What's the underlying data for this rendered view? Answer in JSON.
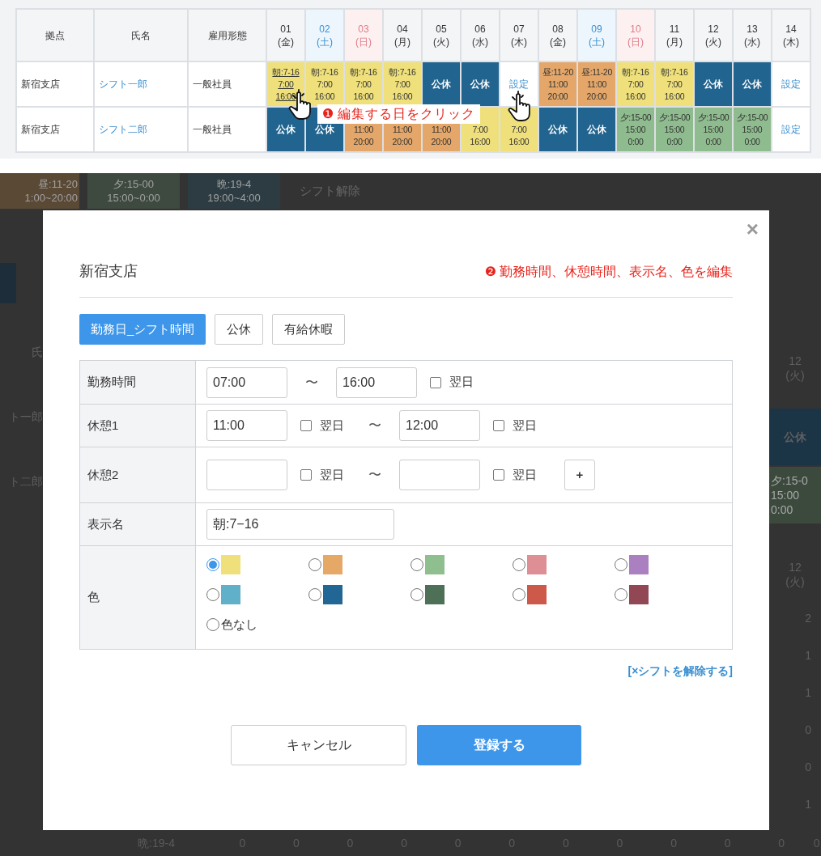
{
  "schedule_table": {
    "columns": [
      "拠点",
      "氏名",
      "雇用形態"
    ],
    "days": [
      {
        "date": "01",
        "weekday": "(金)",
        "kind": "weekday"
      },
      {
        "date": "02",
        "weekday": "(土)",
        "kind": "saturday"
      },
      {
        "date": "03",
        "weekday": "(日)",
        "kind": "sunday"
      },
      {
        "date": "04",
        "weekday": "(月)",
        "kind": "weekday"
      },
      {
        "date": "05",
        "weekday": "(火)",
        "kind": "weekday"
      },
      {
        "date": "06",
        "weekday": "(水)",
        "kind": "weekday"
      },
      {
        "date": "07",
        "weekday": "(木)",
        "kind": "weekday"
      },
      {
        "date": "08",
        "weekday": "(金)",
        "kind": "weekday"
      },
      {
        "date": "09",
        "weekday": "(土)",
        "kind": "saturday"
      },
      {
        "date": "10",
        "weekday": "(日)",
        "kind": "sunday"
      },
      {
        "date": "11",
        "weekday": "(月)",
        "kind": "weekday"
      },
      {
        "date": "12",
        "weekday": "(火)",
        "kind": "weekday"
      },
      {
        "date": "13",
        "weekday": "(水)",
        "kind": "weekday"
      },
      {
        "date": "14",
        "weekday": "(木)",
        "kind": "weekday"
      }
    ],
    "rows": [
      {
        "base": "新宿支店",
        "name": "シフト一郎",
        "employment": "一般社員",
        "cells": [
          {
            "kind": "shift",
            "color": "#efe07c",
            "lines": [
              "朝:7-16",
              "7:00",
              "16:00"
            ],
            "hovered": true
          },
          {
            "kind": "shift",
            "color": "#efe07c",
            "lines": [
              "朝:7-16",
              "7:00",
              "16:00"
            ],
            "hovered": false
          },
          {
            "kind": "shift",
            "color": "#efe07c",
            "lines": [
              "朝:7-16",
              "7:00",
              "16:00"
            ],
            "hovered": false
          },
          {
            "kind": "shift",
            "color": "#efe07c",
            "lines": [
              "朝:7-16",
              "7:00",
              "16:00"
            ],
            "hovered": false
          },
          {
            "kind": "holiday",
            "lines": [
              "公休"
            ],
            "hovered": false
          },
          {
            "kind": "holiday",
            "lines": [
              "公休"
            ],
            "hovered": false
          },
          {
            "kind": "unset",
            "lines": [
              "設定"
            ],
            "hovered": false
          },
          {
            "kind": "shift",
            "color": "#e4a769",
            "lines": [
              "昼:11-20",
              "11:00",
              "20:00"
            ],
            "hovered": false
          },
          {
            "kind": "shift",
            "color": "#e4a769",
            "lines": [
              "昼:11-20",
              "11:00",
              "20:00"
            ],
            "hovered": false
          },
          {
            "kind": "shift",
            "color": "#efe07c",
            "lines": [
              "朝:7-16",
              "7:00",
              "16:00"
            ],
            "hovered": false
          },
          {
            "kind": "shift",
            "color": "#efe07c",
            "lines": [
              "朝:7-16",
              "7:00",
              "16:00"
            ],
            "hovered": false
          },
          {
            "kind": "holiday",
            "lines": [
              "公休"
            ],
            "hovered": false
          },
          {
            "kind": "holiday",
            "lines": [
              "公休"
            ],
            "hovered": false
          },
          {
            "kind": "unset",
            "lines": [
              "設定"
            ],
            "hovered": false
          }
        ]
      },
      {
        "base": "新宿支店",
        "name": "シフト二郎",
        "employment": "一般社員",
        "cells": [
          {
            "kind": "holiday",
            "lines": [
              "公休"
            ],
            "hovered": false
          },
          {
            "kind": "holiday",
            "lines": [
              "公休"
            ],
            "hovered": false
          },
          {
            "kind": "shift",
            "color": "#e4a769",
            "lines": [
              "11:00",
              "20:00"
            ],
            "hovered": false
          },
          {
            "kind": "shift",
            "color": "#e4a769",
            "lines": [
              "11:00",
              "20:00"
            ],
            "hovered": false
          },
          {
            "kind": "shift",
            "color": "#e4a769",
            "lines": [
              "11:00",
              "20:00"
            ],
            "hovered": false
          },
          {
            "kind": "shift",
            "color": "#efe07c",
            "lines": [
              "7:00",
              "16:00"
            ],
            "hovered": false
          },
          {
            "kind": "shift",
            "color": "#efe07c",
            "lines": [
              "7:00",
              "16:00"
            ],
            "hovered": false
          },
          {
            "kind": "holiday",
            "lines": [
              "公休"
            ],
            "hovered": false
          },
          {
            "kind": "holiday",
            "lines": [
              "公休"
            ],
            "hovered": false
          },
          {
            "kind": "shift",
            "color": "#8fbc8f",
            "lines": [
              "夕:15-00",
              "15:00",
              "0:00"
            ],
            "hovered": false
          },
          {
            "kind": "shift",
            "color": "#8fbc8f",
            "lines": [
              "夕:15-00",
              "15:00",
              "0:00"
            ],
            "hovered": false
          },
          {
            "kind": "shift",
            "color": "#8fbc8f",
            "lines": [
              "夕:15-00",
              "15:00",
              "0:00"
            ],
            "hovered": false
          },
          {
            "kind": "shift",
            "color": "#8fbc8f",
            "lines": [
              "夕:15-00",
              "15:00",
              "0:00"
            ],
            "hovered": false
          },
          {
            "kind": "unset",
            "lines": [
              "設定"
            ],
            "hovered": false
          }
        ]
      }
    ]
  },
  "callout": {
    "number": "❶",
    "text": "編集する日をクリック"
  },
  "background_page": {
    "shift_buttons": [
      {
        "name": "昼:11-20",
        "time": "1:00~20:00",
        "color": "#5a4935"
      },
      {
        "name": "夕:15-00",
        "time": "15:00~0:00",
        "color": "#3e4a40"
      },
      {
        "name": "晩:19-4",
        "time": "19:00~4:00",
        "color": "#2c3c42"
      }
    ],
    "clear_button": "シフト解除",
    "left_column": [
      "氏",
      "ト一郎",
      "ト二郎"
    ],
    "right_column": [
      {
        "kind": "header",
        "lines": [
          "12",
          "(火)"
        ]
      },
      {
        "kind": "holiday",
        "lines": [
          "公休"
        ]
      },
      {
        "kind": "shift",
        "lines": [
          "夕:15-0",
          "15:00",
          "0:00"
        ]
      },
      {
        "kind": "header",
        "lines": [
          "12",
          "(火)"
        ]
      },
      {
        "kind": "count",
        "lines": [
          "2"
        ]
      },
      {
        "kind": "count",
        "lines": [
          "1"
        ]
      },
      {
        "kind": "count",
        "lines": [
          "1"
        ]
      },
      {
        "kind": "count",
        "lines": [
          "0"
        ]
      },
      {
        "kind": "count",
        "lines": [
          "0"
        ]
      },
      {
        "kind": "count",
        "lines": [
          "1"
        ]
      }
    ],
    "bottom_row": {
      "label": "晩:19-4",
      "values": [
        "0",
        "0",
        "0",
        "0",
        "0",
        "0",
        "0",
        "0",
        "0",
        "0",
        "0",
        "0"
      ]
    }
  },
  "dialog": {
    "title": "新宿支店",
    "close": "×",
    "annotation": {
      "number": "❷",
      "text": "勤務時間、休憩時間、表示名、色を編集"
    },
    "tabs": [
      {
        "label": "勤務日_シフト時間",
        "selected": true
      },
      {
        "label": "公休",
        "selected": false
      },
      {
        "label": "有給休暇",
        "selected": false
      }
    ],
    "form": [
      {
        "label": "勤務時間",
        "items": [
          {
            "kind": "input",
            "value": "07:00"
          },
          {
            "kind": "separator",
            "text": "〜"
          },
          {
            "kind": "input",
            "value": "16:00"
          },
          {
            "kind": "checkbox",
            "label": "翌日",
            "checked": false
          }
        ]
      },
      {
        "label": "休憩1",
        "items": [
          {
            "kind": "input",
            "value": "11:00"
          },
          {
            "kind": "checkbox",
            "label": "翌日",
            "checked": false
          },
          {
            "kind": "separator",
            "text": "〜"
          },
          {
            "kind": "input",
            "value": "12:00"
          },
          {
            "kind": "checkbox",
            "label": "翌日",
            "checked": false
          }
        ]
      },
      {
        "label": "休憩2",
        "items": [
          {
            "kind": "input"
          },
          {
            "kind": "checkbox",
            "label": "翌日",
            "checked": false
          },
          {
            "kind": "separator",
            "text": "〜"
          },
          {
            "kind": "input"
          },
          {
            "kind": "checkbox",
            "label": "翌日",
            "checked": false
          },
          {
            "kind": "button",
            "text": "+"
          }
        ]
      },
      {
        "label": "表示名",
        "items": [
          {
            "kind": "wide_input",
            "value": "朝:7−16"
          }
        ]
      },
      {
        "label": "色",
        "items": [
          {
            "kind": "colors",
            "options": [
              {
                "color": "#efe07c",
                "selected": true
              },
              {
                "color": "#e6a867",
                "selected": false
              },
              {
                "color": "#8fbf8f",
                "selected": false
              },
              {
                "color": "#de8e95",
                "selected": false
              },
              {
                "color": "#aa80c0",
                "selected": false
              },
              {
                "color": "#5fb0c8",
                "selected": false
              },
              {
                "color": "#216694",
                "selected": false
              },
              {
                "color": "#4e7056",
                "selected": false
              },
              {
                "color": "#cd594b",
                "selected": false
              },
              {
                "color": "#914754",
                "selected": false
              },
              {
                "label": "色なし",
                "selected": false
              }
            ]
          }
        ]
      }
    ],
    "clear_link": "[×シフトを解除する]",
    "buttons": [
      {
        "label": "キャンセル",
        "kind": "secondary"
      },
      {
        "label": "登録する",
        "kind": "primary"
      }
    ]
  }
}
